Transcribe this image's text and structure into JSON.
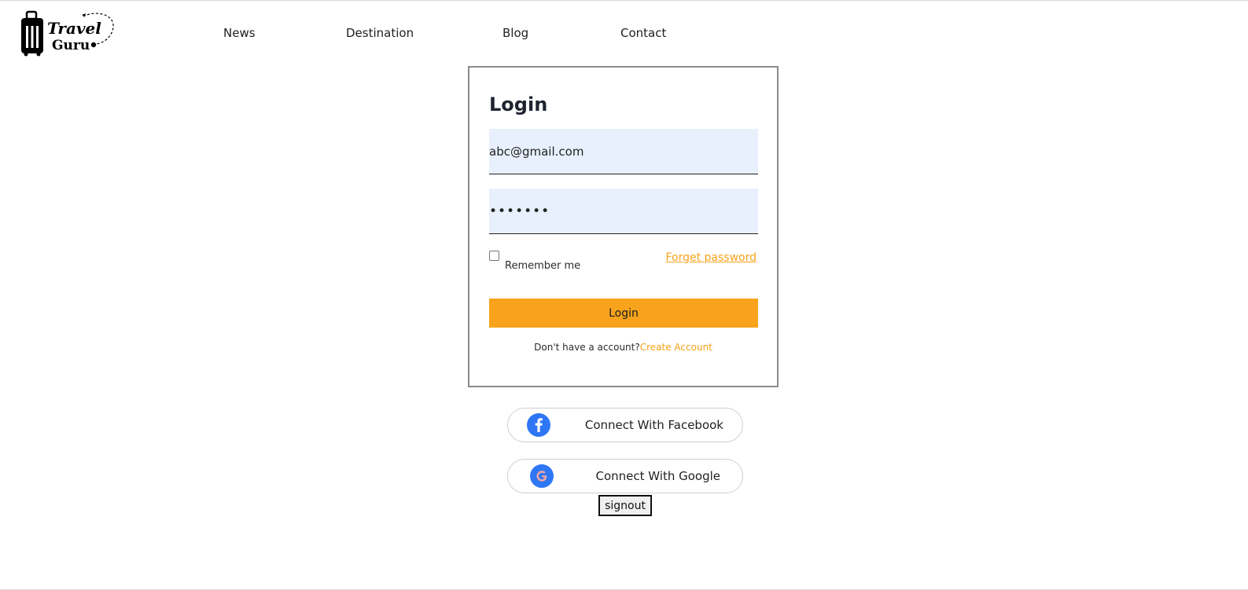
{
  "header": {
    "logo": {
      "line1": "Travel",
      "line2": "Guru",
      "icon": "suitcase-icon"
    },
    "nav": [
      {
        "label": "News"
      },
      {
        "label": "Destination"
      },
      {
        "label": "Blog"
      },
      {
        "label": "Contact"
      }
    ]
  },
  "login": {
    "title": "Login",
    "email_value": "abc@gmail.com",
    "password_value": "•••••••",
    "remember_label": "Remember me",
    "remember_checked": false,
    "forget_label": "Forget password",
    "submit_label": "Login",
    "no_account_text": "Don't have a account?",
    "create_account_label": "Create Account"
  },
  "social": {
    "facebook_label": "Connect With Facebook",
    "facebook_icon": "facebook-icon",
    "google_label": "Connect With Google",
    "google_icon": "google-icon"
  },
  "signout_label": "signout",
  "colors": {
    "accent": "#f8a31b",
    "input_bg": "#e8f0fe",
    "social_icon_bg": "#2f76f5",
    "card_border": "#8f8a8a"
  }
}
